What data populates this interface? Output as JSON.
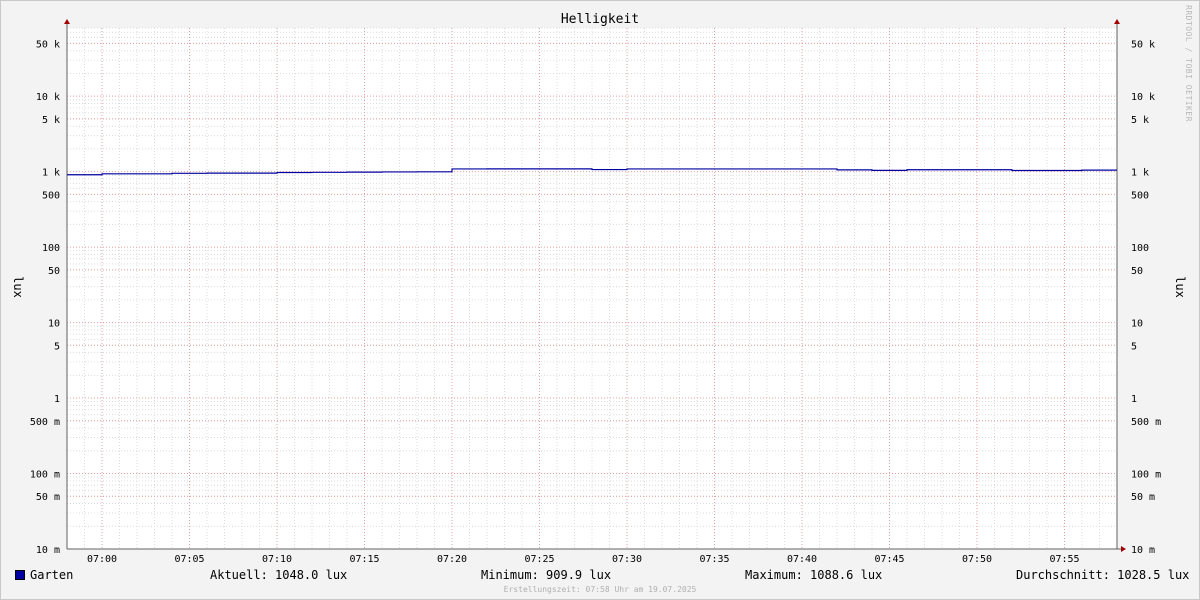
{
  "chart_data": {
    "type": "line",
    "title": "Helligkeit",
    "ylabel": "lux",
    "yscale": "log",
    "ylim": [
      0.01,
      80000
    ],
    "xlim": [
      "06:58",
      "07:58"
    ],
    "y_ticks": [
      {
        "value": 50000,
        "label": "50 k"
      },
      {
        "value": 10000,
        "label": "10 k"
      },
      {
        "value": 5000,
        "label": "5 k"
      },
      {
        "value": 1000,
        "label": "1 k"
      },
      {
        "value": 500,
        "label": "500"
      },
      {
        "value": 100,
        "label": "100"
      },
      {
        "value": 50,
        "label": "50"
      },
      {
        "value": 10,
        "label": "10"
      },
      {
        "value": 5,
        "label": "5"
      },
      {
        "value": 1,
        "label": "1"
      },
      {
        "value": 0.5,
        "label": "500 m"
      },
      {
        "value": 0.1,
        "label": "100 m"
      },
      {
        "value": 0.05,
        "label": "50 m"
      },
      {
        "value": 0.01,
        "label": "10 m"
      }
    ],
    "x_ticks": [
      "07:00",
      "07:05",
      "07:10",
      "07:15",
      "07:20",
      "07:25",
      "07:30",
      "07:35",
      "07:40",
      "07:45",
      "07:50",
      "07:55"
    ],
    "grid": true,
    "series": [
      {
        "name": "Garten",
        "color": "#0000a0",
        "x": [
          "06:58",
          "07:00",
          "07:02",
          "07:04",
          "07:06",
          "07:08",
          "07:10",
          "07:12",
          "07:14",
          "07:16",
          "07:18",
          "07:20",
          "07:22",
          "07:24",
          "07:26",
          "07:28",
          "07:30",
          "07:32",
          "07:34",
          "07:36",
          "07:38",
          "07:40",
          "07:42",
          "07:44",
          "07:46",
          "07:48",
          "07:50",
          "07:52",
          "07:54",
          "07:56",
          "07:58"
        ],
        "values": [
          910,
          935,
          935,
          950,
          955,
          955,
          975,
          980,
          985,
          990,
          995,
          1085,
          1088,
          1088,
          1088,
          1065,
          1085,
          1085,
          1085,
          1085,
          1085,
          1085,
          1055,
          1040,
          1060,
          1060,
          1060,
          1035,
          1035,
          1048,
          1048
        ]
      }
    ]
  },
  "legend": {
    "series_label": "Garten",
    "current": "Aktuell: 1048.0 lux",
    "minimum": "Minimum: 909.9 lux",
    "maximum": "Maximum: 1088.6 lux",
    "average": "Durchschnitt: 1028.5 lux"
  },
  "footer": "Erstellungszeit: 07:58 Uhr am 19.07.2025",
  "watermark": "RRDTOOL / TOBI OETIKER"
}
